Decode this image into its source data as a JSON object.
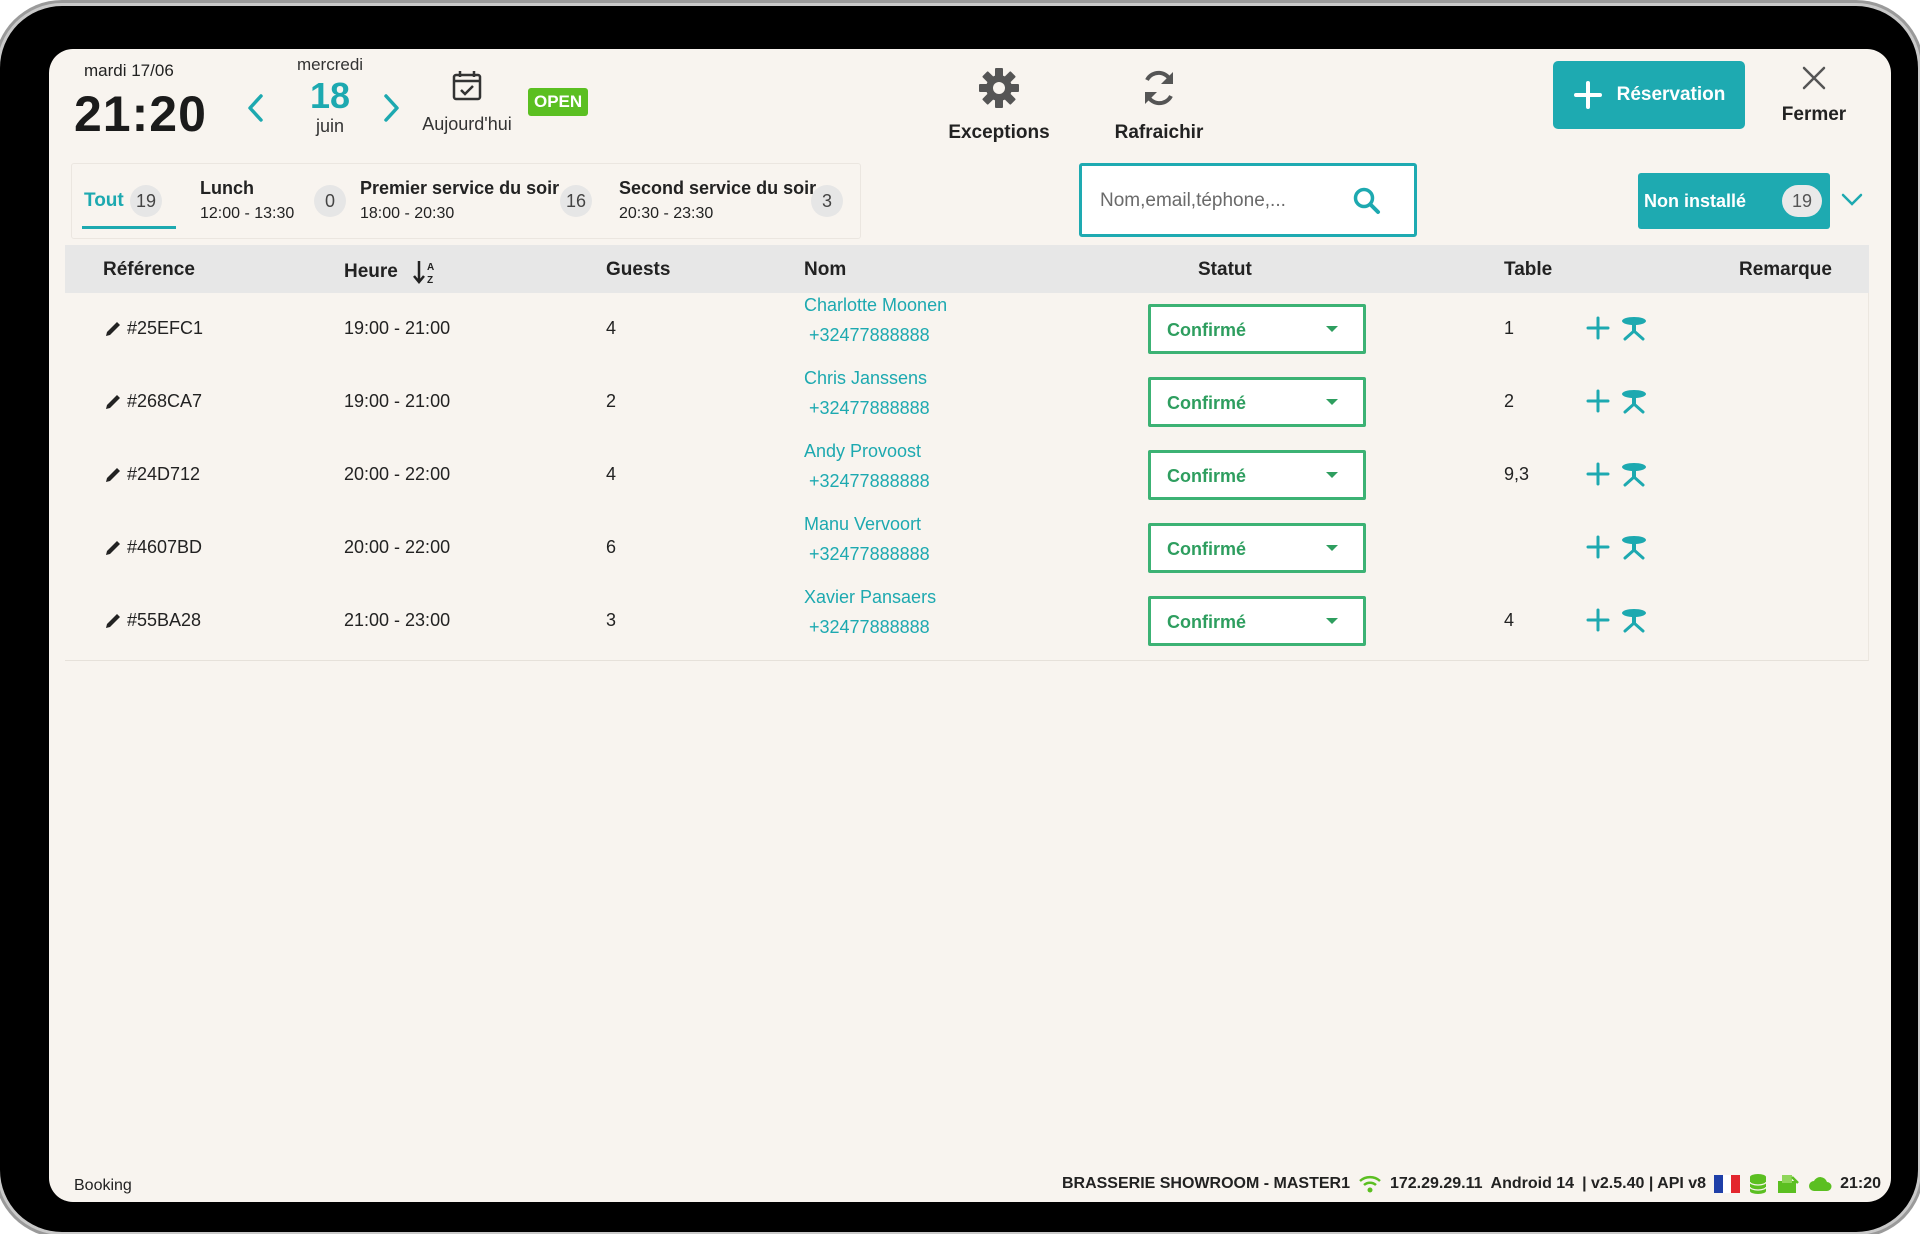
{
  "header": {
    "current_date": "mardi 17/06",
    "current_time": "21:20",
    "selected_day_name": "mercredi",
    "selected_day_number": "18",
    "selected_month": "juin",
    "today_label": "Aujourd'hui",
    "open_badge": "OPEN",
    "exceptions_label": "Exceptions",
    "refresh_label": "Rafraichir",
    "reservation_button": "Réservation",
    "close_label": "Fermer"
  },
  "services": [
    {
      "title": "Tout",
      "time": "",
      "count": "19"
    },
    {
      "title": "Lunch",
      "time": "12:00 - 13:30",
      "count": "0"
    },
    {
      "title": "Premier service du soir",
      "time": "18:00 - 20:30",
      "count": "16"
    },
    {
      "title": "Second service du soir",
      "time": "20:30 - 23:30",
      "count": "3"
    }
  ],
  "search": {
    "placeholder": "Nom,email,téphone,..."
  },
  "filter": {
    "label": "Non installé",
    "count": "19"
  },
  "table": {
    "columns": [
      "Référence",
      "Heure",
      "Guests",
      "Nom",
      "Statut",
      "Table",
      "Remarque"
    ],
    "rows": [
      {
        "ref": "#25EFC1",
        "time": "19:00 - 21:00",
        "guests": "4",
        "name": "Charlotte Moonen",
        "phone": "+32477888888",
        "status": "Confirmé",
        "table": "1",
        "remark": ""
      },
      {
        "ref": "#268CA7",
        "time": "19:00 - 21:00",
        "guests": "2",
        "name": "Chris Janssens",
        "phone": "+32477888888",
        "status": "Confirmé",
        "table": "2",
        "remark": ""
      },
      {
        "ref": "#24D712",
        "time": "20:00 - 22:00",
        "guests": "4",
        "name": "Andy Provoost",
        "phone": "+32477888888",
        "status": "Confirmé",
        "table": "9,3",
        "remark": ""
      },
      {
        "ref": "#4607BD",
        "time": "20:00 - 22:00",
        "guests": "6",
        "name": "Manu Vervoort",
        "phone": "+32477888888",
        "status": "Confirmé",
        "table": "",
        "remark": ""
      },
      {
        "ref": "#55BA28",
        "time": "21:00 - 23:00",
        "guests": "3",
        "name": "Xavier Pansaers",
        "phone": "+32477888888",
        "status": "Confirmé",
        "table": "4",
        "remark": ""
      }
    ]
  },
  "statusbar": {
    "left": "Booking",
    "venue": "BRASSERIE SHOWROOM - MASTER1",
    "ip": "172.29.29.11",
    "os": "Android 14",
    "version": "| v2.5.40 | API v8",
    "time": "21:20"
  },
  "colors": {
    "accent": "#1eaab1",
    "open": "#5bbf21",
    "confirmed": "#3cb274",
    "background": "#f8f4ef"
  },
  "icons": [
    "chevron-left-icon",
    "chevron-right-icon",
    "calendar-check-icon",
    "gear-icon",
    "refresh-icon",
    "plus-icon",
    "close-icon",
    "search-icon",
    "chevron-down-icon",
    "sort-icon",
    "pencil-icon",
    "caret-down-icon",
    "seat-icon",
    "wifi-icon",
    "flag-icon",
    "database-icon",
    "printer-icon",
    "cloud-icon"
  ]
}
